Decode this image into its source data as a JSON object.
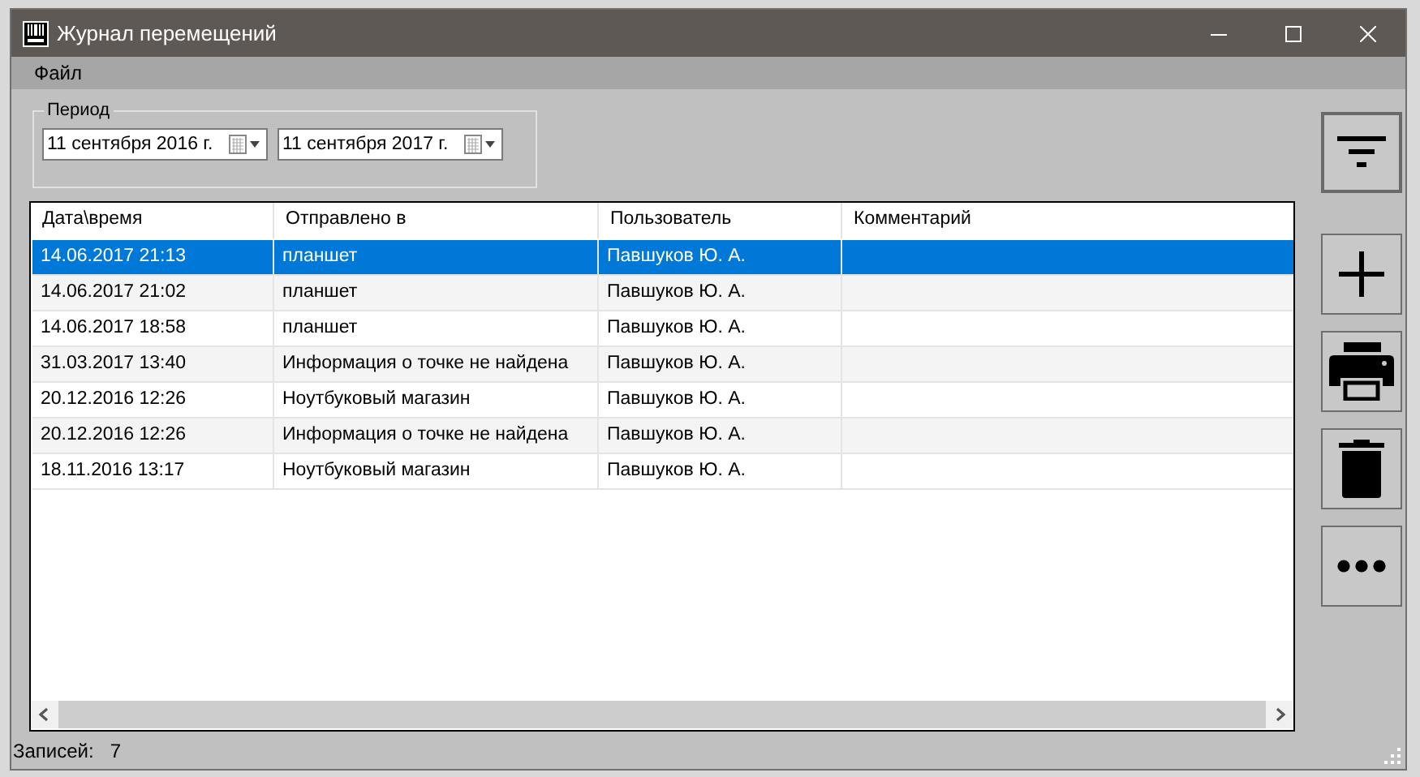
{
  "window": {
    "title": "Журнал перемещений"
  },
  "menu": [
    "Файл"
  ],
  "period": {
    "label": "Период",
    "from": "11 сентября 2016 г.",
    "to": "11 сентября 2017 г."
  },
  "table": {
    "columns": [
      "Дата\\время",
      "Отправлено в",
      "Пользователь",
      "Комментарий"
    ],
    "rows": [
      {
        "cells": [
          "14.06.2017 21:13",
          "планшет",
          "Павшуков Ю. А."
        ],
        "selected": true
      },
      {
        "cells": [
          "14.06.2017 21:02",
          "планшет",
          "Павшуков Ю. А."
        ],
        "selected": false
      },
      {
        "cells": [
          "14.06.2017 18:58",
          "планшет",
          "Павшуков Ю. А."
        ],
        "selected": false
      },
      {
        "cells": [
          "31.03.2017 13:40",
          "Информация о точке не найдена",
          "Павшуков Ю. А."
        ],
        "selected": false
      },
      {
        "cells": [
          "20.12.2016 12:26",
          "Ноутбуковый магазин",
          "Павшуков Ю. А."
        ],
        "selected": false
      },
      {
        "cells": [
          "20.12.2016 12:26",
          "Информация о точке не найдена",
          "Павшуков Ю. А."
        ],
        "selected": false
      },
      {
        "cells": [
          "18.11.2016 13:17",
          "Ноутбуковый магазин",
          "Павшуков Ю. А."
        ],
        "selected": false
      }
    ]
  },
  "tools": [
    {
      "kind": "filter"
    },
    {
      "kind": "add"
    },
    {
      "kind": "print"
    },
    {
      "kind": "delete"
    },
    {
      "kind": "more"
    }
  ],
  "status": {
    "label": "Записей:",
    "count": "7"
  }
}
